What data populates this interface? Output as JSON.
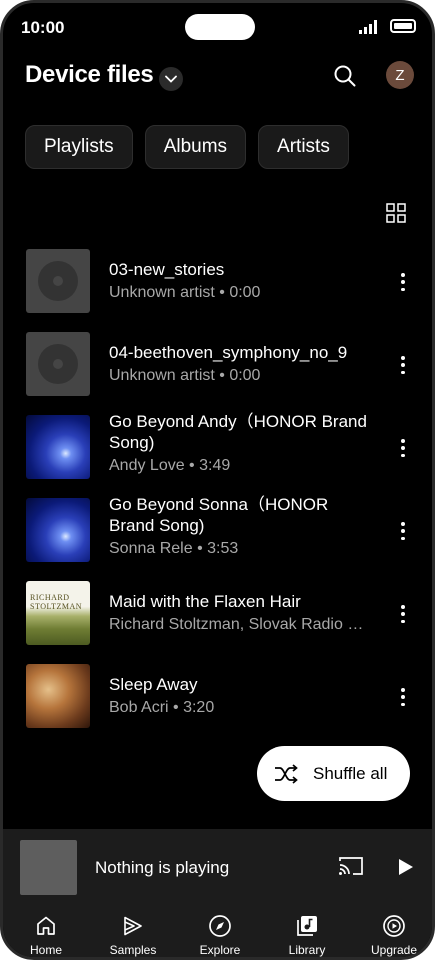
{
  "status": {
    "time": "10:00"
  },
  "header": {
    "title": "Device files",
    "avatar_letter": "Z"
  },
  "chips": [
    "Playlists",
    "Albums",
    "Artists"
  ],
  "songs": [
    {
      "title": "03-new_stories",
      "subtitle": "Unknown artist • 0:00",
      "art": "generic"
    },
    {
      "title": "04-beethoven_symphony_no_9",
      "subtitle": "Unknown artist • 0:00",
      "art": "generic"
    },
    {
      "title": "Go Beyond Andy（HONOR Brand Song)",
      "subtitle": "Andy Love • 3:49",
      "art": "blue"
    },
    {
      "title": "Go Beyond Sonna（HONOR Brand Song)",
      "subtitle": "Sonna Rele • 3:53",
      "art": "blue"
    },
    {
      "title": "Maid with the Flaxen Hair",
      "subtitle": "Richard Stoltzman, Slovak Radio …",
      "art": "richard",
      "art_text": "RICHARD STOLTZMAN"
    },
    {
      "title": "Sleep Away",
      "subtitle": "Bob Acri • 3:20",
      "art": "sleep"
    }
  ],
  "shuffle": {
    "label": "Shuffle all"
  },
  "player": {
    "status": "Nothing is playing"
  },
  "nav": [
    {
      "label": "Home",
      "icon": "home-icon"
    },
    {
      "label": "Samples",
      "icon": "samples-icon"
    },
    {
      "label": "Explore",
      "icon": "compass-icon"
    },
    {
      "label": "Library",
      "icon": "library-icon"
    },
    {
      "label": "Upgrade",
      "icon": "upgrade-icon"
    }
  ]
}
